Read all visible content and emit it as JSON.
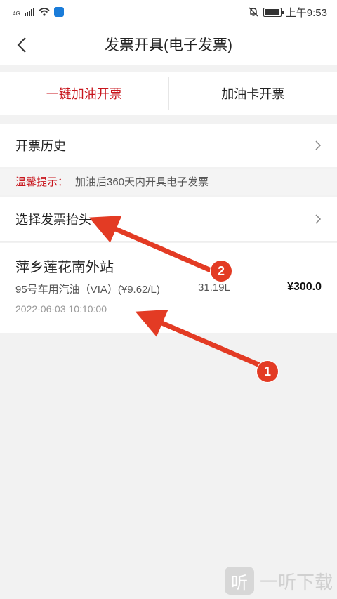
{
  "status_bar": {
    "network": "4G",
    "time": "上午9:53"
  },
  "nav": {
    "title": "发票开具(电子发票)"
  },
  "tabs": [
    {
      "label": "一键加油开票",
      "active": true
    },
    {
      "label": "加油卡开票",
      "active": false
    }
  ],
  "history": {
    "label": "开票历史"
  },
  "tip": {
    "label": "温馨提示：",
    "text": "加油后360天内开具电子发票"
  },
  "invoice_header": {
    "label": "选择发票抬头"
  },
  "order": {
    "station": "萍乡莲花南外站",
    "fuel": "95号车用汽油（VIA）(¥9.62/L)",
    "volume": "31.19L",
    "amount": "¥300.0",
    "datetime": "2022-06-03 10:10:00"
  },
  "annotations": {
    "badge1": "1",
    "badge2": "2"
  },
  "watermark": {
    "logo_char": "听",
    "text": "一听下载"
  },
  "colors": {
    "accent": "#c8161d",
    "annotation": "#e33b24"
  }
}
